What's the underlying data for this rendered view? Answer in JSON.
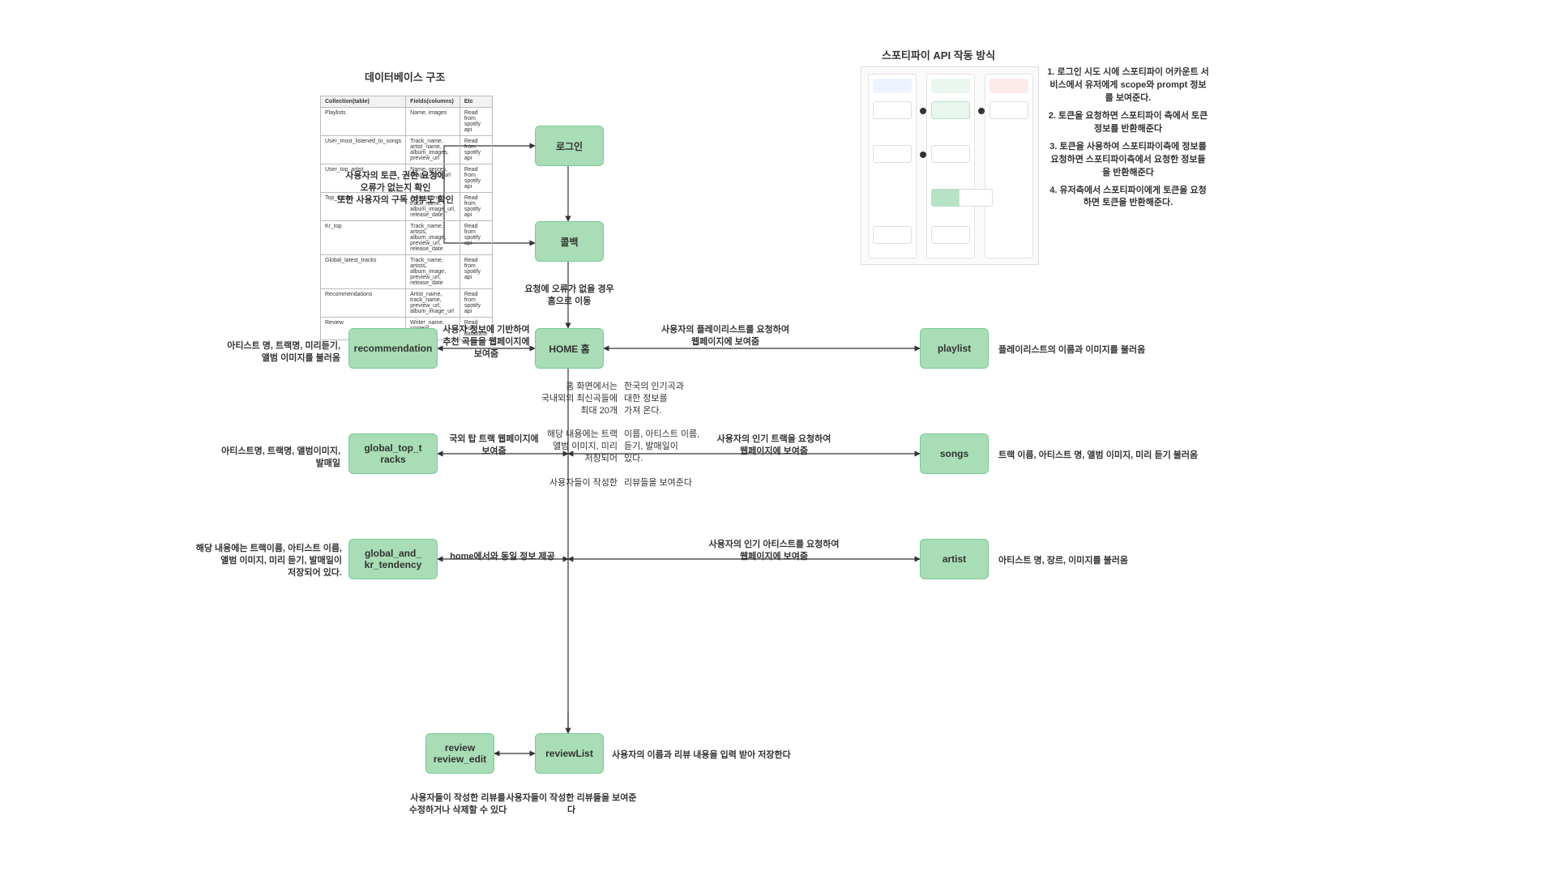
{
  "headings": {
    "db": "데이터베이스 구조",
    "api": "스포티파이 API 작동 방식"
  },
  "nodes": {
    "login": "로그인",
    "callback": "콜백",
    "home": "HOME 홈",
    "recommendation": "recommendation",
    "global_top_tracks": "global_top_t\nracks",
    "global_kr_tendency": "global_and_\nkr_tendency",
    "review_edit": "review\nreview_edit",
    "reviewList": "reviewList",
    "playlist": "playlist",
    "songs": "songs",
    "artist": "artist"
  },
  "labels": {
    "login_cb": "사용자의 토큰, 권한 요청에\n오류가 없는지 확인\n또한 사용자의 구독 여부도 확인",
    "cb_home": "요청에 오류가 없을 경우\n홈으로 이동",
    "home_rec": "사용자 정보에 기반하여\n추천 곡들을 웹페이지에 보여줌",
    "rec_desc": "아티스트 명, 트랙명, 미리듣기,\n앨범 이미지를 불러옴",
    "home_body_left": "홈 화면에서는\n국내외의 최신곡들에\n최대 20개\n\n해당 내용에는 트랙\n앨범 이미지, 미리\n저장되어\n\n사용자들이 작성한",
    "home_body_right": "한국의 인기곡과\n대한 정보를\n가져 온다.\n\n이름, 아티스트 이름,\n듣기, 발매일이\n있다.\n\n리뷰들을 보여준다",
    "home_gtt": "국외 탑 트랙 웹페이지에\n보여줌",
    "gtt_desc": "아티스트명, 트랙명, 앨범이미지,\n발매일",
    "home_gkt": "home에서와 동일 정보 제공",
    "gkt_desc": "해당 내용에는 트랙이름, 아티스트 이름,\n앨범 이미지, 미리 듣기, 발매일이\n저장되어 있다.",
    "home_playlist": "사용자의 플레이리스트를 요청하여\n웹페이지에 보여줌",
    "playlist_desc": "플레이리스트의 이름과 이미지를 불러옴",
    "home_songs": "사용자의 인기 트랙을 요청하여\n웹페이지에 보여줌",
    "songs_desc": "트랙 이름, 아티스트 명, 앨범 이미지, 미리 듣기 불러옴",
    "home_artist": "사용자의 인기 아티스트를 요청하여\n웹페이지에 보여줌",
    "artist_desc": "아티스트 명, 장르, 이미지를 불러옴",
    "review_desc": "사용자들이 작성한 리뷰를\n수정하거나 삭제할 수 있다",
    "reviewList_right": "사용자의 이름과 리뷰 내용을 입력 받아 저장한다",
    "reviewList_below": "사용자들이 작성한 리뷰들을 보여준다"
  },
  "db_table": {
    "headers": [
      "Collection(table)",
      "Fields(columns)",
      "Etc"
    ],
    "rows": [
      [
        "Playlists",
        "Name, images",
        "Read from spotify api"
      ],
      [
        "User_most_listened_to_songs",
        "Track_name, artist_name, album_images, preview_url",
        "Read from spotify api"
      ],
      [
        "User_top_artist",
        "Name, genres, images_320_url",
        "Read from spotify api"
      ],
      [
        "Top_tracks",
        "Artist_name, track_name, album_image_url, release_date",
        "Read from spotify api"
      ],
      [
        "Kr_top",
        "Track_name, artists, album_image, preview_url, release_date",
        "Read from spotify api"
      ],
      [
        "Global_latest_tracks",
        "Track_name, artists, album_image, preview_url, release_date",
        "Read from spotify api"
      ],
      [
        "Recommendations",
        "Artist_name, track_name, preview_url, album_image_url",
        "Read from spotify api"
      ],
      [
        "Review",
        "Writer_name, content",
        "Read from database"
      ]
    ]
  },
  "api_steps": {
    "s1": "1.   로그인 시도 시에 스포티파이\n어카운트 서비스에서 유저에게\nscope와 prompt 정보를 보여준다.",
    "s2": "2. 토큰을 요청하면\n스포티파이 측에서\n토큰 정보를 반환해준다",
    "s3": "3. 토큰을 사용하여\n스포티파이측에 정보를 요청하면\n스포티파이측에서 요청한\n정보들을 반환해준다",
    "s4": "4. 유저측에서 스포티파이에게\n토큰을 요청하면\n토큰을 반환해준다."
  }
}
